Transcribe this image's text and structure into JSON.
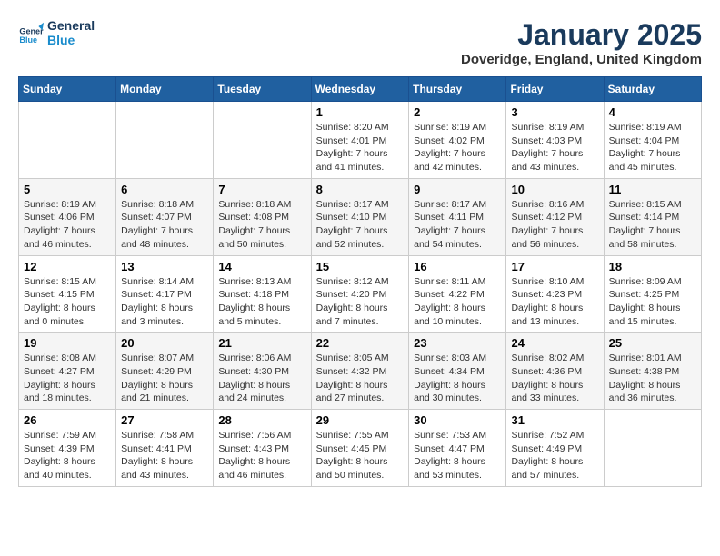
{
  "logo": {
    "line1": "General",
    "line2": "Blue"
  },
  "title": "January 2025",
  "subtitle": "Doveridge, England, United Kingdom",
  "days_of_week": [
    "Sunday",
    "Monday",
    "Tuesday",
    "Wednesday",
    "Thursday",
    "Friday",
    "Saturday"
  ],
  "weeks": [
    [
      {
        "day": "",
        "info": ""
      },
      {
        "day": "",
        "info": ""
      },
      {
        "day": "",
        "info": ""
      },
      {
        "day": "1",
        "info": "Sunrise: 8:20 AM\nSunset: 4:01 PM\nDaylight: 7 hours\nand 41 minutes."
      },
      {
        "day": "2",
        "info": "Sunrise: 8:19 AM\nSunset: 4:02 PM\nDaylight: 7 hours\nand 42 minutes."
      },
      {
        "day": "3",
        "info": "Sunrise: 8:19 AM\nSunset: 4:03 PM\nDaylight: 7 hours\nand 43 minutes."
      },
      {
        "day": "4",
        "info": "Sunrise: 8:19 AM\nSunset: 4:04 PM\nDaylight: 7 hours\nand 45 minutes."
      }
    ],
    [
      {
        "day": "5",
        "info": "Sunrise: 8:19 AM\nSunset: 4:06 PM\nDaylight: 7 hours\nand 46 minutes."
      },
      {
        "day": "6",
        "info": "Sunrise: 8:18 AM\nSunset: 4:07 PM\nDaylight: 7 hours\nand 48 minutes."
      },
      {
        "day": "7",
        "info": "Sunrise: 8:18 AM\nSunset: 4:08 PM\nDaylight: 7 hours\nand 50 minutes."
      },
      {
        "day": "8",
        "info": "Sunrise: 8:17 AM\nSunset: 4:10 PM\nDaylight: 7 hours\nand 52 minutes."
      },
      {
        "day": "9",
        "info": "Sunrise: 8:17 AM\nSunset: 4:11 PM\nDaylight: 7 hours\nand 54 minutes."
      },
      {
        "day": "10",
        "info": "Sunrise: 8:16 AM\nSunset: 4:12 PM\nDaylight: 7 hours\nand 56 minutes."
      },
      {
        "day": "11",
        "info": "Sunrise: 8:15 AM\nSunset: 4:14 PM\nDaylight: 7 hours\nand 58 minutes."
      }
    ],
    [
      {
        "day": "12",
        "info": "Sunrise: 8:15 AM\nSunset: 4:15 PM\nDaylight: 8 hours\nand 0 minutes."
      },
      {
        "day": "13",
        "info": "Sunrise: 8:14 AM\nSunset: 4:17 PM\nDaylight: 8 hours\nand 3 minutes."
      },
      {
        "day": "14",
        "info": "Sunrise: 8:13 AM\nSunset: 4:18 PM\nDaylight: 8 hours\nand 5 minutes."
      },
      {
        "day": "15",
        "info": "Sunrise: 8:12 AM\nSunset: 4:20 PM\nDaylight: 8 hours\nand 7 minutes."
      },
      {
        "day": "16",
        "info": "Sunrise: 8:11 AM\nSunset: 4:22 PM\nDaylight: 8 hours\nand 10 minutes."
      },
      {
        "day": "17",
        "info": "Sunrise: 8:10 AM\nSunset: 4:23 PM\nDaylight: 8 hours\nand 13 minutes."
      },
      {
        "day": "18",
        "info": "Sunrise: 8:09 AM\nSunset: 4:25 PM\nDaylight: 8 hours\nand 15 minutes."
      }
    ],
    [
      {
        "day": "19",
        "info": "Sunrise: 8:08 AM\nSunset: 4:27 PM\nDaylight: 8 hours\nand 18 minutes."
      },
      {
        "day": "20",
        "info": "Sunrise: 8:07 AM\nSunset: 4:29 PM\nDaylight: 8 hours\nand 21 minutes."
      },
      {
        "day": "21",
        "info": "Sunrise: 8:06 AM\nSunset: 4:30 PM\nDaylight: 8 hours\nand 24 minutes."
      },
      {
        "day": "22",
        "info": "Sunrise: 8:05 AM\nSunset: 4:32 PM\nDaylight: 8 hours\nand 27 minutes."
      },
      {
        "day": "23",
        "info": "Sunrise: 8:03 AM\nSunset: 4:34 PM\nDaylight: 8 hours\nand 30 minutes."
      },
      {
        "day": "24",
        "info": "Sunrise: 8:02 AM\nSunset: 4:36 PM\nDaylight: 8 hours\nand 33 minutes."
      },
      {
        "day": "25",
        "info": "Sunrise: 8:01 AM\nSunset: 4:38 PM\nDaylight: 8 hours\nand 36 minutes."
      }
    ],
    [
      {
        "day": "26",
        "info": "Sunrise: 7:59 AM\nSunset: 4:39 PM\nDaylight: 8 hours\nand 40 minutes."
      },
      {
        "day": "27",
        "info": "Sunrise: 7:58 AM\nSunset: 4:41 PM\nDaylight: 8 hours\nand 43 minutes."
      },
      {
        "day": "28",
        "info": "Sunrise: 7:56 AM\nSunset: 4:43 PM\nDaylight: 8 hours\nand 46 minutes."
      },
      {
        "day": "29",
        "info": "Sunrise: 7:55 AM\nSunset: 4:45 PM\nDaylight: 8 hours\nand 50 minutes."
      },
      {
        "day": "30",
        "info": "Sunrise: 7:53 AM\nSunset: 4:47 PM\nDaylight: 8 hours\nand 53 minutes."
      },
      {
        "day": "31",
        "info": "Sunrise: 7:52 AM\nSunset: 4:49 PM\nDaylight: 8 hours\nand 57 minutes."
      },
      {
        "day": "",
        "info": ""
      }
    ]
  ]
}
